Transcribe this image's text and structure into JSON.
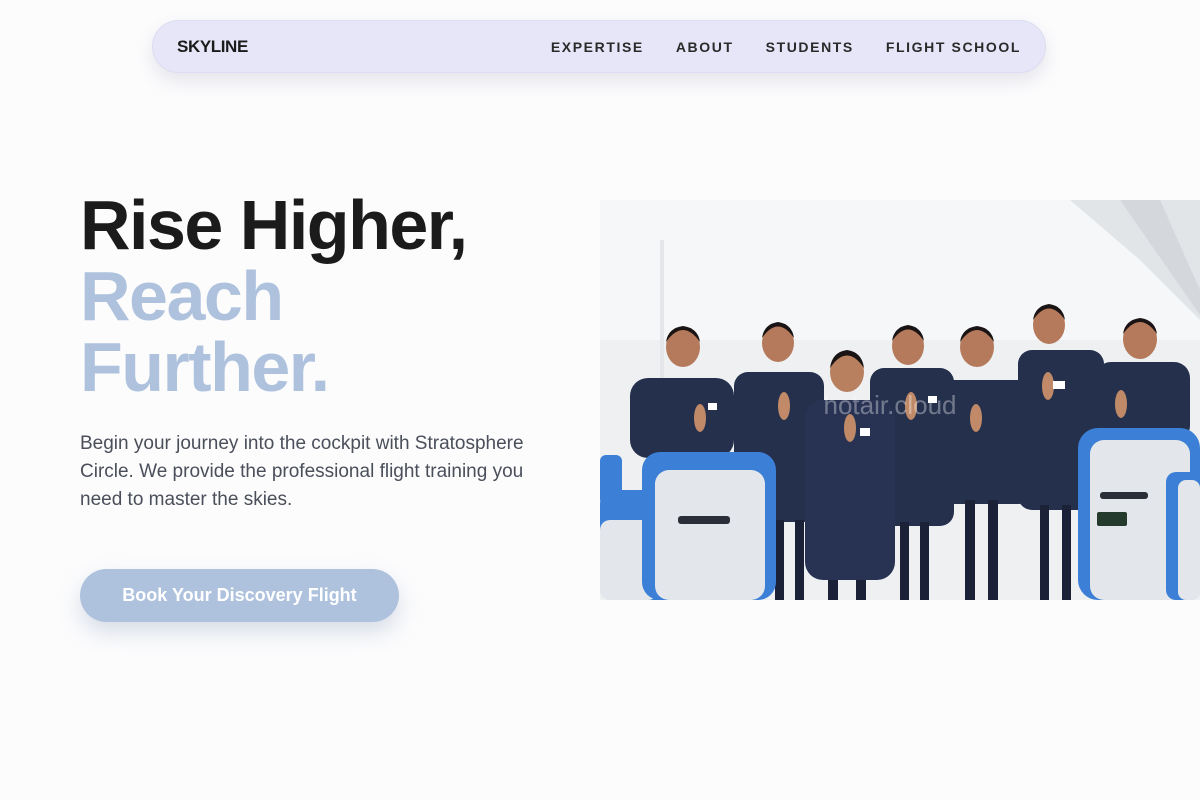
{
  "nav": {
    "brand": "SKYLINE",
    "links": [
      "EXPERTISE",
      "ABOUT",
      "STUDENTS",
      "FLIGHT SCHOOL"
    ]
  },
  "hero": {
    "headline_line1": "Rise Higher,",
    "headline_line2": "Reach",
    "headline_line3": "Further.",
    "description": "Begin your journey into the cockpit with Stratosphere Circle. We provide the professional flight training you need to master the skies.",
    "cta_label": "Book Your Discovery Flight",
    "image_watermark": "hotair.cloud"
  },
  "colors": {
    "accent": "#aec2dd",
    "nav_background": "#e6e6f8",
    "text_dark": "#1b1b1b",
    "uniform_navy": "#25304d",
    "seat_blue": "#3c7fd6"
  }
}
